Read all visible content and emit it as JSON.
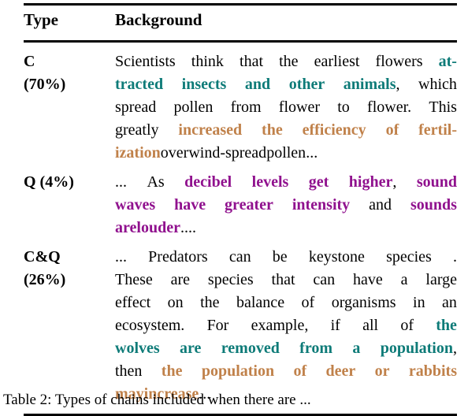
{
  "table": {
    "columns": {
      "type": "Type",
      "background": "Background"
    },
    "rows": [
      {
        "type_label": "C",
        "type_percent": "(70%)",
        "lines": [
          [
            {
              "t": "Scientists think that the earliest flowers ",
              "s": "plain"
            },
            {
              "t": "at-",
              "s": "teal"
            }
          ],
          [
            {
              "t": "tracted insects and other animals",
              "s": "teal"
            },
            {
              "t": ", which",
              "s": "plain"
            }
          ],
          [
            {
              "t": "spread pollen from flower to flower.  This",
              "s": "plain"
            }
          ],
          [
            {
              "t": "greatly ",
              "s": "plain"
            },
            {
              "t": "increased the efficiency of fertil-",
              "s": "orange"
            }
          ],
          [
            {
              "t": "ization",
              "s": "orange"
            },
            {
              "t": " over wind-spread pollen ...",
              "s": "plain"
            }
          ]
        ]
      },
      {
        "type_label": "Q (4%)",
        "type_percent": "",
        "lines": [
          [
            {
              "t": "...  As ",
              "s": "plain"
            },
            {
              "t": "decibel levels get higher",
              "s": "purple"
            },
            {
              "t": ", ",
              "s": "plain"
            },
            {
              "t": "sound",
              "s": "purple"
            }
          ],
          [
            {
              "t": "waves have greater intensity",
              "s": "purple"
            },
            {
              "t": " and ",
              "s": "plain"
            },
            {
              "t": "sounds",
              "s": "purple"
            }
          ],
          [
            {
              "t": "are louder",
              "s": "purple"
            },
            {
              "t": ". ...",
              "s": "plain"
            }
          ]
        ]
      },
      {
        "type_label": "C&Q",
        "type_percent": "(26%)",
        "lines": [
          [
            {
              "t": "...   Predators can be keystone species .",
              "s": "plain"
            }
          ],
          [
            {
              "t": "These are species that can have a large",
              "s": "plain"
            }
          ],
          [
            {
              "t": "effect on the balance of organisms in an",
              "s": "plain"
            }
          ],
          [
            {
              "t": "ecosystem.   For example, if all of ",
              "s": "plain"
            },
            {
              "t": "the",
              "s": "teal"
            }
          ],
          [
            {
              "t": "wolves are removed from a population",
              "s": "teal"
            },
            {
              "t": ",",
              "s": "plain"
            }
          ],
          [
            {
              "t": "then ",
              "s": "plain"
            },
            {
              "t": "the population of deer or rabbits",
              "s": "orange"
            }
          ],
          [
            {
              "t": "may increase",
              "s": "orange"
            },
            {
              "t": "...",
              "s": "plain"
            }
          ]
        ]
      }
    ]
  },
  "caption": {
    "text": "Table 2: Types of chains included when there are ..."
  },
  "colors": {
    "teal": "#0e7b78",
    "orange": "#c0814a",
    "purple": "#90118e",
    "rule": "#000000"
  }
}
